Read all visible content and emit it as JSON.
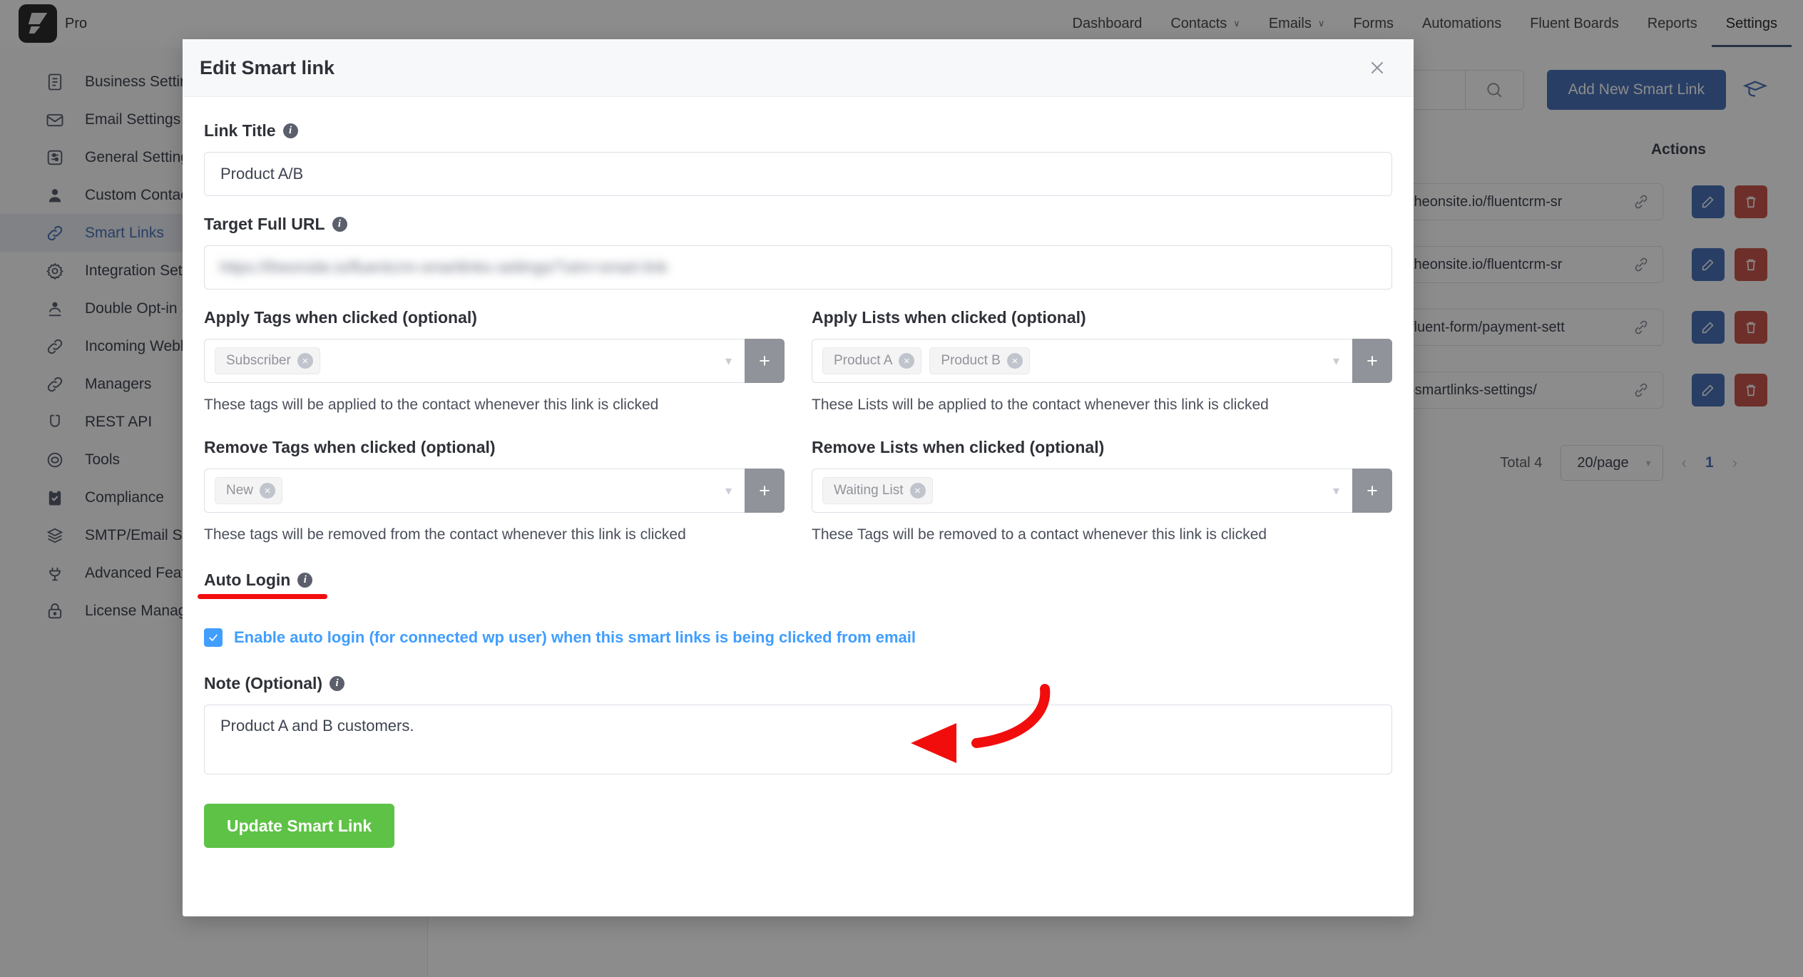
{
  "topbar": {
    "logo_label": "Pro",
    "nav": [
      {
        "label": "Dashboard",
        "caret": ""
      },
      {
        "label": "Contacts",
        "caret": "∨"
      },
      {
        "label": "Emails",
        "caret": "∨"
      },
      {
        "label": "Forms",
        "caret": ""
      },
      {
        "label": "Automations",
        "caret": ""
      },
      {
        "label": "Fluent Boards",
        "caret": ""
      },
      {
        "label": "Reports",
        "caret": ""
      },
      {
        "label": "Settings",
        "caret": ""
      }
    ]
  },
  "sidebar": {
    "items": [
      {
        "label": "Business Settings",
        "icon": "document-icon"
      },
      {
        "label": "Email Settings",
        "icon": "envelope-icon"
      },
      {
        "label": "General Settings",
        "icon": "sliders-icon"
      },
      {
        "label": "Custom Contact Fields",
        "icon": "user-icon"
      },
      {
        "label": "Smart Links",
        "icon": "link-icon"
      },
      {
        "label": "Integration Settings",
        "icon": "gear-icon"
      },
      {
        "label": "Double Opt-in Settings",
        "icon": "person-check-icon"
      },
      {
        "label": "Incoming Webhooks",
        "icon": "link-icon"
      },
      {
        "label": "Managers",
        "icon": "link-icon"
      },
      {
        "label": "REST API",
        "icon": "magnet-icon"
      },
      {
        "label": "Tools",
        "icon": "circle-icon"
      },
      {
        "label": "Compliance",
        "icon": "clipboard-check-icon"
      },
      {
        "label": "SMTP/Email Service",
        "icon": "stack-icon"
      },
      {
        "label": "Advanced Features",
        "icon": "plug-icon"
      },
      {
        "label": "License Management",
        "icon": "lock-icon"
      }
    ],
    "selected_index": 4
  },
  "content": {
    "search_placeholder": "",
    "add_button_label": "Add New Smart Link",
    "graduation_icon": "graduation-cap-icon",
    "table": {
      "actions_header": "Actions",
      "rows": [
        {
          "url": "theonsite.io/fluentcrm-sr"
        },
        {
          "url": "theonsite.io/fluentcrm-sr"
        },
        {
          "url": "fluent-form/payment-sett"
        },
        {
          "url": "-smartlinks-settings/"
        }
      ]
    },
    "pagination": {
      "total_label": "Total 4",
      "per_page": "20/page",
      "prev": "‹",
      "page": "1",
      "next": "›"
    }
  },
  "modal": {
    "title": "Edit Smart link",
    "close_icon": "close-icon",
    "link_title": {
      "label": "Link Title",
      "value": "Product A/B",
      "placeholder": "Link Title"
    },
    "target_url": {
      "label": "Target Full URL",
      "value": "https://theonsite.io/fluentcrm-smartlinks-settings/?utm=smart-link",
      "placeholder": "Target Full URL",
      "redacted": true
    },
    "apply_tags": {
      "label": "Apply Tags when clicked (optional)",
      "chips": [
        "Subscriber"
      ],
      "add_label": "+",
      "help": "These tags will be applied to the contact whenever this link is clicked"
    },
    "apply_lists": {
      "label": "Apply Lists when clicked (optional)",
      "chips": [
        "Product A",
        "Product B"
      ],
      "add_label": "+",
      "help": "These Lists will be applied to the contact whenever this link is clicked"
    },
    "remove_tags": {
      "label": "Remove Tags when clicked (optional)",
      "chips": [
        "New"
      ],
      "add_label": "+",
      "help": "These tags will be removed from the contact whenever this link is clicked"
    },
    "remove_lists": {
      "label": "Remove Lists when clicked (optional)",
      "chips": [
        "Waiting List"
      ],
      "add_label": "+",
      "help": "These Tags will be removed to a contact whenever this link is clicked"
    },
    "auto_login": {
      "label": "Auto Login",
      "checkbox_label": "Enable auto login (for connected wp user) when this smart links is being clicked from email",
      "checked": true
    },
    "note": {
      "label": "Note (Optional)",
      "value": "Product A and B customers.",
      "placeholder": "Note"
    },
    "submit_label": "Update Smart Link"
  },
  "annotation": {
    "highlight_color": "#f20d0d",
    "arrow_color": "#f20d0d",
    "underline_target": "Auto Login",
    "arrow_target": "auto-login-checkbox-label"
  }
}
